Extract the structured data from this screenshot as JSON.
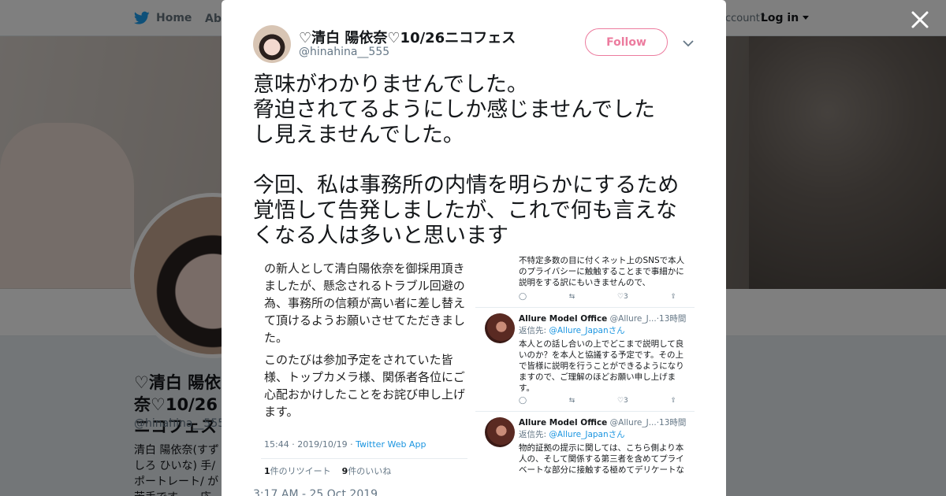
{
  "nav": {
    "home_label": "Home",
    "about_label": "Abo",
    "account_text": "ccount?",
    "login_label": "Log in"
  },
  "profile_bg": {
    "name": "♡清白 陽依奈♡10/26ニコフェス",
    "handle": "@hinahina__555",
    "bio": "清白 陽依奈(すずしろ ひいな) 手/ポートレート/ が苦手です…。応 …/meru.hina3034"
  },
  "tweet": {
    "author_name": "♡清白 陽依奈♡10/26ニコフェス",
    "author_handle": "@hinahina__555",
    "follow_label": "Follow",
    "text_lines": [
      "意味がわかりませんでした。",
      "脅迫されてるようにしか感じませんでした",
      "し見えませんでした。",
      "今回、私は事務所の内情を明らかにするため",
      "覚悟して告発しましたが、これで何も言えな",
      "くなる人は多いと思います"
    ],
    "date": "3:17 AM - 25 Oct 2019"
  },
  "media": {
    "left": {
      "paragraph1": "の新人として清白陽依奈を御採用頂きましたが、懸念されるトラブル回避の為、事務所の信頼が高い者に差し替えて頂けるようお願いさせてただきました。",
      "paragraph2": "このたびは参加予定をされていた皆様、トップカメラ様、関係者各位にご心配おかけしたことをお詫び申し上げます。",
      "meta_time": "15:44 · 2019/10/19 · ",
      "meta_app": "Twitter Web App",
      "retweets_count": "1",
      "retweets_label": "件のリツイート",
      "likes_count": "9",
      "likes_label": "件のいいね"
    },
    "right": {
      "top_text": "不特定多数の目に付くネット上のSNSで本人のプライバシーに触触することまで事細かに説明をする訳にもいきませんので、",
      "top_likes": "3",
      "reply1": {
        "name": "Allure Model Office",
        "handle": "@Allure_J...",
        "time": "·13時間",
        "reply_prefix": "返信先: ",
        "reply_to": "@Allure_Japanさん",
        "text": "本人との話し合いの上でどこまで説明して良いのか？を本人と協議する予定です。その上で皆様に説明を行うことができるようになりますので、ご理解のほどお願い申し上げます。",
        "likes": "3"
      },
      "reply2": {
        "name": "Allure Model Office",
        "handle": "@Allure_J...",
        "time": "·13時間",
        "reply_prefix": "返信先: ",
        "reply_to": "@Allure_Japanさん",
        "text": "物的証拠の提示に関しては、こちら側より本人の、そして関係する第三者を含めてプライベートな部分に接触する極めてデリケートな"
      }
    }
  },
  "colors": {
    "accent_blue": "#1da1f2",
    "follow_pink": "#e0245e",
    "link_blue": "#1b95e0"
  },
  "icons": {
    "close": "close-icon",
    "twitter": "twitter-bird-icon",
    "caret": "chevron-down-icon"
  }
}
